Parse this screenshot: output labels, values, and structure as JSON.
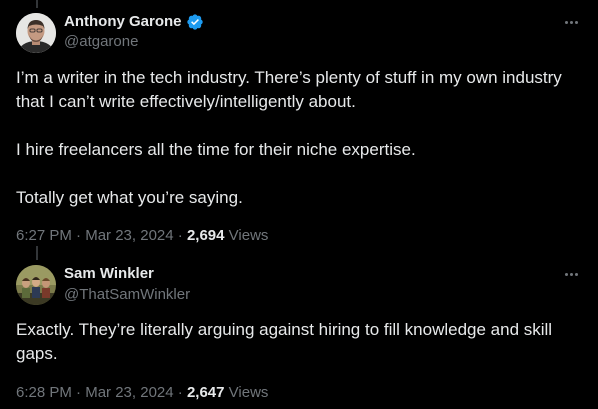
{
  "tweets": [
    {
      "author": {
        "display_name": "Anthony Garone",
        "handle": "@atgarone",
        "verified": true
      },
      "paragraphs": [
        "I’m a writer in the tech industry. There’s plenty of stuff in my own industry that I can’t write effectively/intelligently about.",
        "I hire freelancers all the time for their niche expertise.",
        "Totally get what you’re saying."
      ],
      "time": "6:27 PM",
      "date": "Mar 23, 2024",
      "views_count": "2,694",
      "views_label": "Views"
    },
    {
      "author": {
        "display_name": "Sam Winkler",
        "handle": "@ThatSamWinkler",
        "verified": false
      },
      "paragraphs": [
        "Exactly. They’re literally arguing against hiring to fill knowledge and skill gaps."
      ],
      "time": "6:28 PM",
      "date": "Mar 23, 2024",
      "views_count": "2,647",
      "views_label": "Views"
    }
  ],
  "separator": " · ",
  "colors": {
    "background": "#000000",
    "primary_text": "#e7e9ea",
    "secondary_text": "#71767b",
    "verified_blue": "#1d9bf0",
    "thread_line": "#333639"
  },
  "icons": {
    "verified": "verified-badge-icon",
    "more": "more-options-icon"
  }
}
